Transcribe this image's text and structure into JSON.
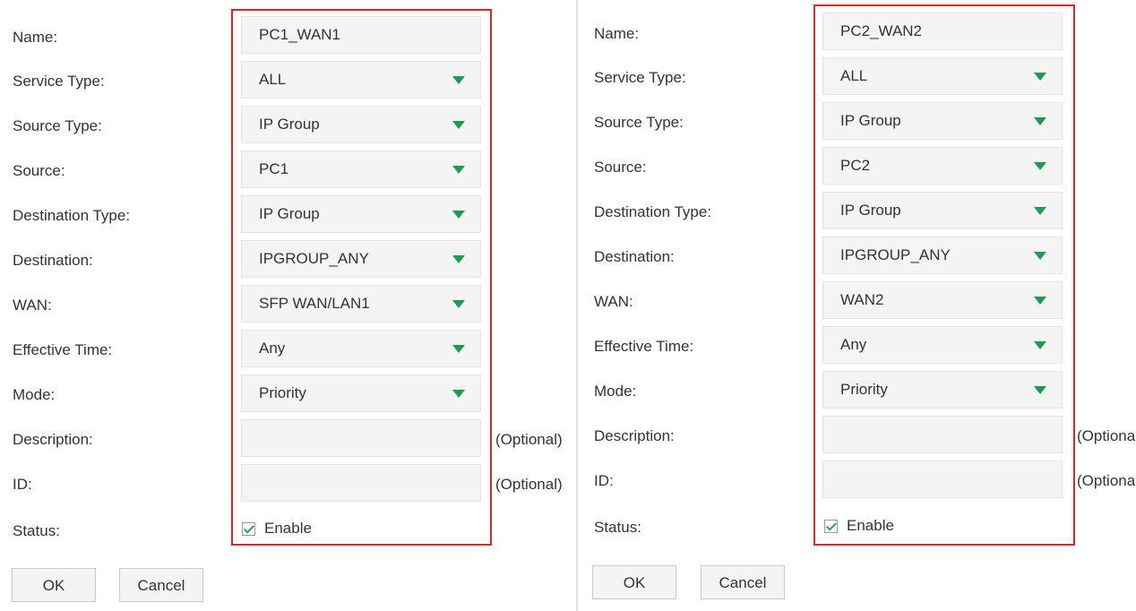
{
  "colors": {
    "accent": "#1f9a52",
    "highlight": "#d9272e",
    "field_bg": "#f4f4f4"
  },
  "left": {
    "labels": {
      "name": "Name:",
      "service_type": "Service Type:",
      "source_type": "Source Type:",
      "source": "Source:",
      "destination_type": "Destination Type:",
      "destination": "Destination:",
      "wan": "WAN:",
      "effective_time": "Effective Time:",
      "mode": "Mode:",
      "description": "Description:",
      "id": "ID:",
      "status": "Status:"
    },
    "values": {
      "name": "PC1_WAN1",
      "service_type": "ALL",
      "source_type": "IP Group",
      "source": "PC1",
      "destination_type": "IP Group",
      "destination": "IPGROUP_ANY",
      "wan": "SFP WAN/LAN1",
      "effective_time": "Any",
      "mode": "Priority",
      "description": "",
      "id": ""
    },
    "optional_label": "(Optional)",
    "status_checked": true,
    "enable_label": "Enable",
    "ok_label": "OK",
    "cancel_label": "Cancel"
  },
  "right": {
    "labels": {
      "name": "Name:",
      "service_type": "Service Type:",
      "source_type": "Source Type:",
      "source": "Source:",
      "destination_type": "Destination Type:",
      "destination": "Destination:",
      "wan": "WAN:",
      "effective_time": "Effective Time:",
      "mode": "Mode:",
      "description": "Description:",
      "id": "ID:",
      "status": "Status:"
    },
    "values": {
      "name": "PC2_WAN2",
      "service_type": "ALL",
      "source_type": "IP Group",
      "source": "PC2",
      "destination_type": "IP Group",
      "destination": "IPGROUP_ANY",
      "wan": "WAN2",
      "effective_time": "Any",
      "mode": "Priority",
      "description": "",
      "id": ""
    },
    "optional_label": "(Optiona",
    "status_checked": true,
    "enable_label": "Enable",
    "ok_label": "OK",
    "cancel_label": "Cancel"
  }
}
